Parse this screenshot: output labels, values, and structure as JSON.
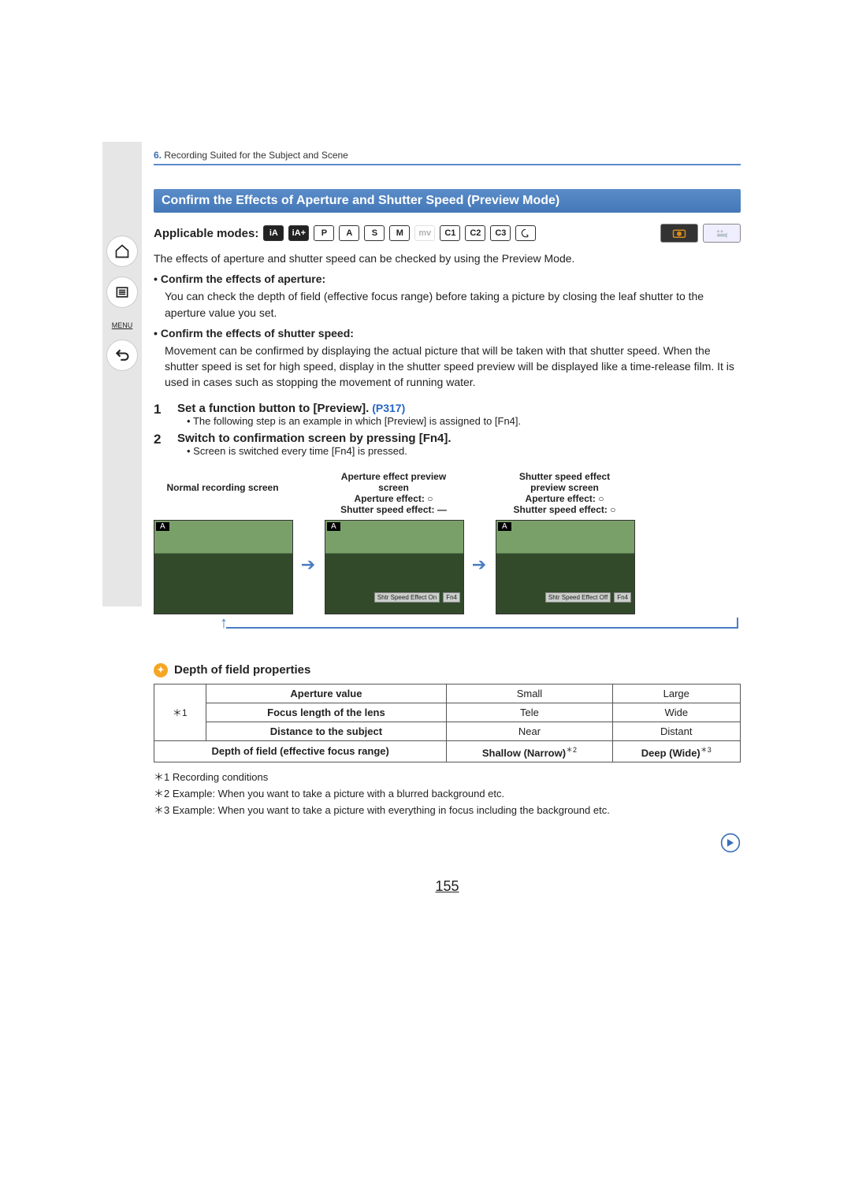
{
  "breadcrumb": {
    "num": "6.",
    "text": "Recording Suited for the Subject and Scene"
  },
  "side_nav": {
    "menu_label": "MENU"
  },
  "section_title": "Confirm the Effects of Aperture and Shutter Speed (Preview Mode)",
  "modes": {
    "label": "Applicable modes:",
    "items": [
      "iA",
      "iA+",
      "P",
      "A",
      "S",
      "M",
      "mv",
      "C1",
      "C2",
      "C3",
      "pal"
    ]
  },
  "intro": "The effects of aperture and shutter speed can be checked by using the Preview Mode.",
  "aperture_block": {
    "heading": "Confirm the effects of aperture:",
    "text": "You can check the depth of field (effective focus range) before taking a picture by closing the leaf shutter to the aperture value you set."
  },
  "shutter_block": {
    "heading": "Confirm the effects of shutter speed:",
    "text": "Movement can be confirmed by displaying the actual picture that will be taken with that shutter speed. When the shutter speed is set for high speed, display in the shutter speed preview will be displayed like a time-release film. It is used in cases such as stopping the movement of running water."
  },
  "steps": [
    {
      "num": "1",
      "title": "Set a function button to [Preview].",
      "ref": "(P317)",
      "note": "The following step is an example in which [Preview] is assigned to [Fn4]."
    },
    {
      "num": "2",
      "title": "Switch to confirmation screen by pressing [Fn4].",
      "ref": "",
      "note": "Screen is switched every time [Fn4] is pressed."
    }
  ],
  "preview_cols": [
    {
      "title1": "",
      "title2": "Normal recording screen",
      "aperture": "",
      "shutter": "",
      "tag": "A",
      "overlay1": "",
      "overlay2": ""
    },
    {
      "title1": "Aperture effect preview",
      "title2": "screen",
      "aperture": "Aperture effect: ○",
      "shutter": "Shutter speed effect: —",
      "tag": "A",
      "overlay1": "Shtr Speed Effect On",
      "overlay2": "Fn4"
    },
    {
      "title1": "Shutter speed effect",
      "title2": "preview screen",
      "aperture": "Aperture effect: ○",
      "shutter": "Shutter speed effect: ○",
      "tag": "A",
      "overlay1": "Shtr Speed Effect Off",
      "overlay2": "Fn4"
    }
  ],
  "dof": {
    "heading": "Depth of field properties",
    "sidecell": "＊1",
    "rows": [
      {
        "label": "Aperture value",
        "small": "Small",
        "large": "Large"
      },
      {
        "label": "Focus length of the lens",
        "small": "Tele",
        "large": "Wide"
      },
      {
        "label": "Distance to the subject",
        "small": "Near",
        "large": "Distant"
      }
    ],
    "last": {
      "label": "Depth of field (effective focus range)",
      "small": "Shallow (Narrow)",
      "small_sup": "＊2",
      "large": "Deep (Wide)",
      "large_sup": "＊3"
    }
  },
  "footnotes": [
    "＊1 Recording conditions",
    "＊2 Example: When you want to take a picture with a blurred background etc.",
    "＊3 Example: When you want to take a picture with everything in focus including the background etc."
  ],
  "page_number": "155"
}
